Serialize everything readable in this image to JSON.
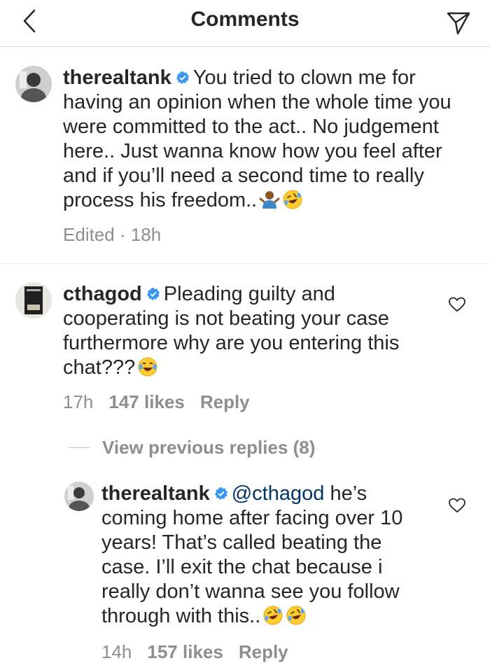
{
  "header": {
    "title": "Comments"
  },
  "icons": {
    "back": "chevron-left-icon",
    "send": "paper-plane-icon",
    "verified": "verified-badge-icon",
    "like": "heart-icon"
  },
  "colors": {
    "verified_blue": "#3897f0",
    "mention": "#003569",
    "meta_gray": "#8e8e8e"
  },
  "caption": {
    "username": "therealtank",
    "text": "You tried to clown me for having an opinion when the whole time you were committed to the act.. No judgement here.. Just wanna know how you feel after and if you’ll need a second time to really process his freedom..",
    "emojis": [
      "person-shrugging-emoji",
      "rofl-emoji"
    ],
    "meta": "Edited · 18h"
  },
  "comments": [
    {
      "username": "cthagod",
      "text": "Pleading guilty and cooperating is not beating your case furthermore why are you entering this chat???",
      "emoji": "tears-of-joy-emoji",
      "time": "17h",
      "likes": "147 likes",
      "reply_label": "Reply",
      "view_previous": "View previous replies (8)"
    },
    {
      "username": "therealtank",
      "mention": "@cthagod",
      "text": "he’s coming home after facing over 10 years! That’s called beating the case. I’ll exit the chat because i really don’t wanna see you follow through with this..",
      "emojis": [
        "rofl-emoji",
        "rofl-emoji"
      ],
      "time": "14h",
      "likes": "157 likes",
      "reply_label": "Reply"
    }
  ]
}
